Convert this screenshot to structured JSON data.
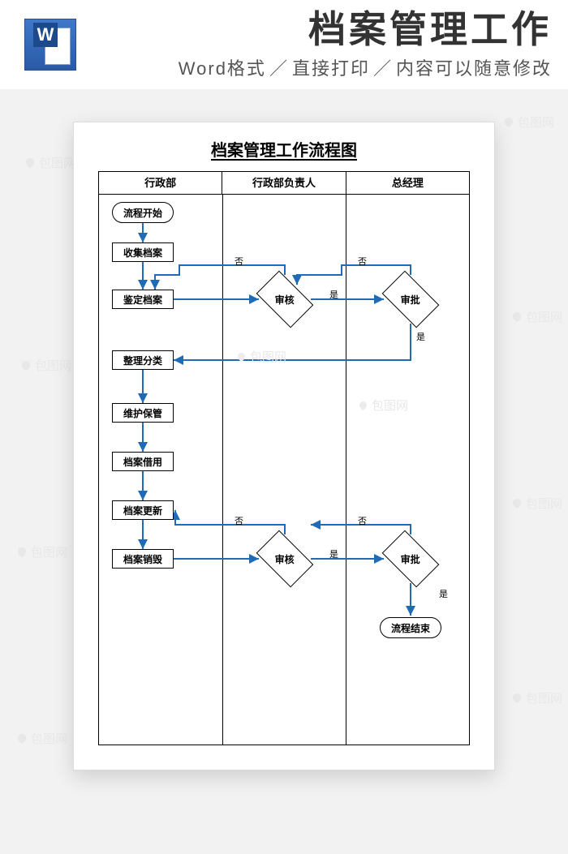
{
  "header": {
    "big_title": "档案管理工作",
    "sub_word": "Word格式",
    "sub_print": "直接打印",
    "sub_edit": "内容可以随意修改"
  },
  "doc_title": "档案管理工作流程图",
  "lanes": [
    "行政部",
    "行政部负责人",
    "总经理"
  ],
  "nodes": {
    "start": "流程开始",
    "collect": "收集档案",
    "identify": "鉴定档案",
    "review1": "审核",
    "approve1": "审批",
    "sort": "整理分类",
    "maintain": "维护保管",
    "borrow": "档案借用",
    "update": "档案更新",
    "review2": "审核",
    "approve2": "审批",
    "destroy": "档案销毁",
    "end": "流程结束"
  },
  "labels": {
    "yes": "是",
    "no": "否"
  },
  "watermark": "包图网",
  "colors": {
    "arrow": "#1f6bb8"
  }
}
